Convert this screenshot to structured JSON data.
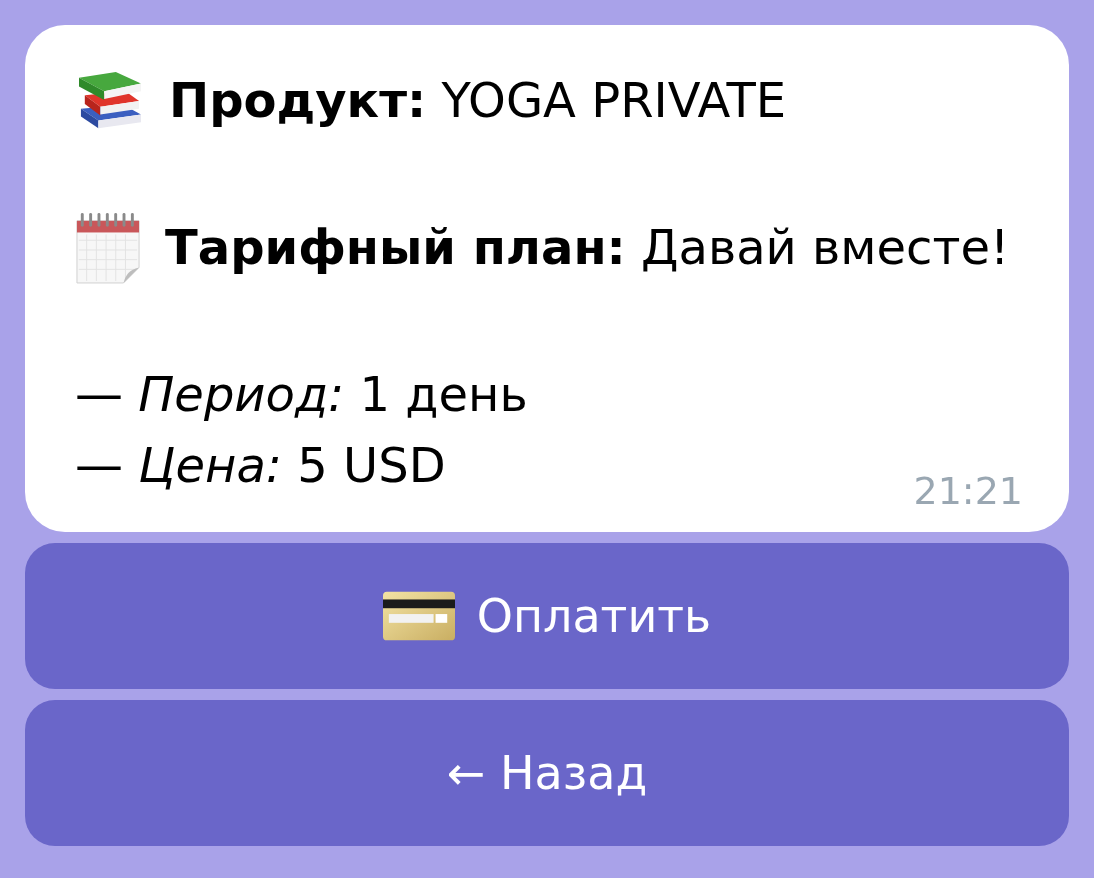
{
  "message": {
    "paragraphs": [
      {
        "lines": [
          {
            "kind": "product",
            "text": "**Продукт:** YOGA PRIVATE"
          }
        ]
      },
      {
        "lines": [
          {
            "kind": "plan",
            "text": "**Тарифный план:** Давай вместе!"
          }
        ]
      },
      {
        "lines": [
          {
            "kind": "detail",
            "text": "— *Период:* 1 день"
          },
          {
            "kind": "detail",
            "text": "— *Цена:* 5 USD"
          }
        ]
      }
    ],
    "time": "21:21"
  },
  "buttons": [
    {
      "kind": "pay",
      "label": "Оплатить"
    },
    {
      "kind": "back",
      "label": "← Назад"
    }
  ]
}
